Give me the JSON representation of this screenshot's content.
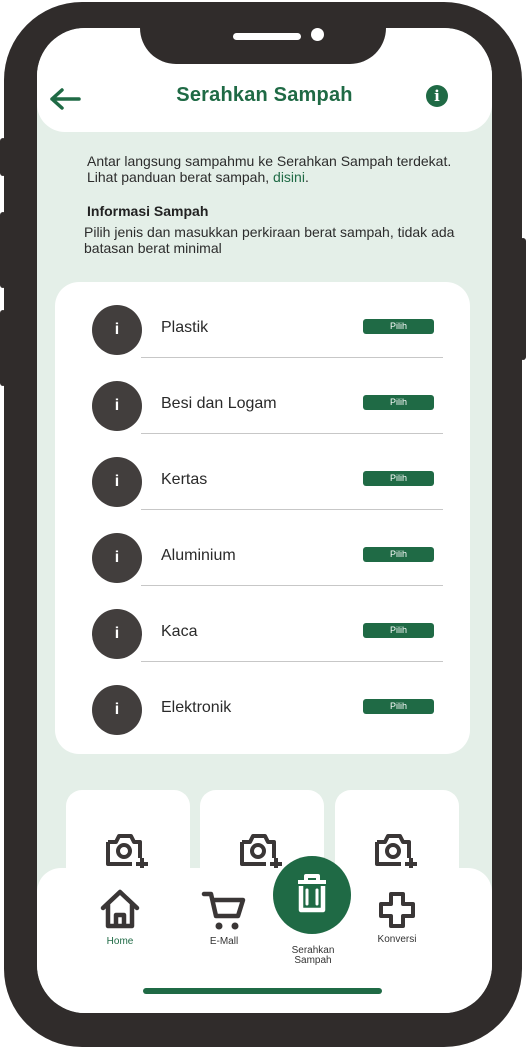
{
  "header": {
    "title": "Serahkan Sampah"
  },
  "intro": {
    "text": "Antar langsung sampahmu ke Serahkan Sampah terdekat. Lihat panduan berat sampah, ",
    "link": "disini",
    "after": "."
  },
  "info_section": {
    "heading": "Informasi Sampah",
    "description": "Pilih jenis dan masukkan perkiraan berat sampah, tidak ada batasan berat minimal"
  },
  "categories": [
    {
      "label": "Plastik",
      "action": "Pilih"
    },
    {
      "label": "Besi dan Logam",
      "action": "Pilih"
    },
    {
      "label": "Kertas",
      "action": "Pilih"
    },
    {
      "label": "Aluminium",
      "action": "Pilih"
    },
    {
      "label": "Kaca",
      "action": "Pilih"
    },
    {
      "label": "Elektronik",
      "action": "Pilih"
    }
  ],
  "info_glyph": "i",
  "bottom_nav": {
    "home": "Home",
    "emall": "E-Mall",
    "serahkan_line1": "Serahkan",
    "serahkan_line2": "Sampah",
    "konversi": "Konversi"
  },
  "colors": {
    "accent": "#1f6a45",
    "background": "#e4efe8",
    "frame": "#302c2b",
    "icon_circle": "#423e3d"
  }
}
